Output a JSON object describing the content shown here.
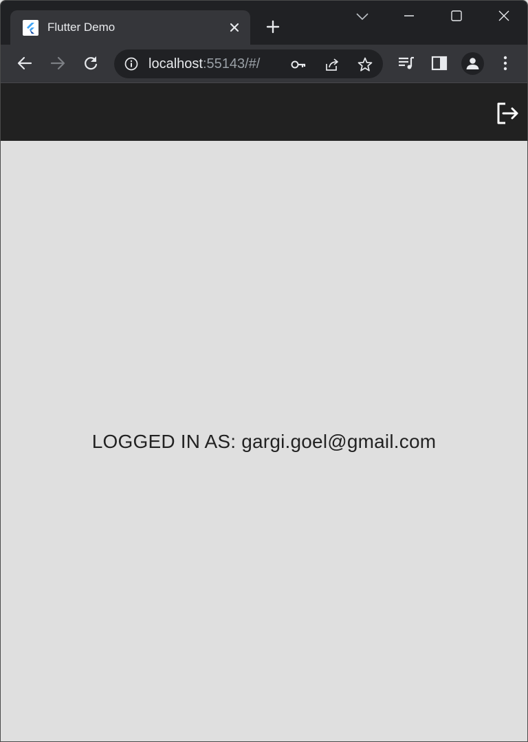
{
  "browser": {
    "tab": {
      "title": "Flutter Demo"
    },
    "address_bar": {
      "host": "localhost",
      "rest": ":55143/#/"
    }
  },
  "app": {
    "status_prefix": "LOGGED IN AS: ",
    "user_email": "gargi.goel@gmail.com"
  },
  "icons": {
    "favicon": "flutter-logo-icon",
    "tab_close": "close-icon",
    "new_tab": "plus-icon",
    "tab_search": "chevron-down-icon",
    "back": "arrow-left-icon",
    "forward": "arrow-right-icon",
    "reload": "reload-icon",
    "site_info": "info-icon",
    "password": "key-icon",
    "share": "share-icon",
    "bookmark": "star-icon",
    "media": "media-queue-icon",
    "side_panel": "side-panel-icon",
    "profile": "person-icon",
    "menu": "kebab-menu-icon",
    "logout": "logout-icon"
  },
  "colors": {
    "tabstrip": "#202124",
    "toolbar": "#35363a",
    "appbar": "#212121",
    "content_bg": "#dfdfdf",
    "text": "#222222"
  }
}
